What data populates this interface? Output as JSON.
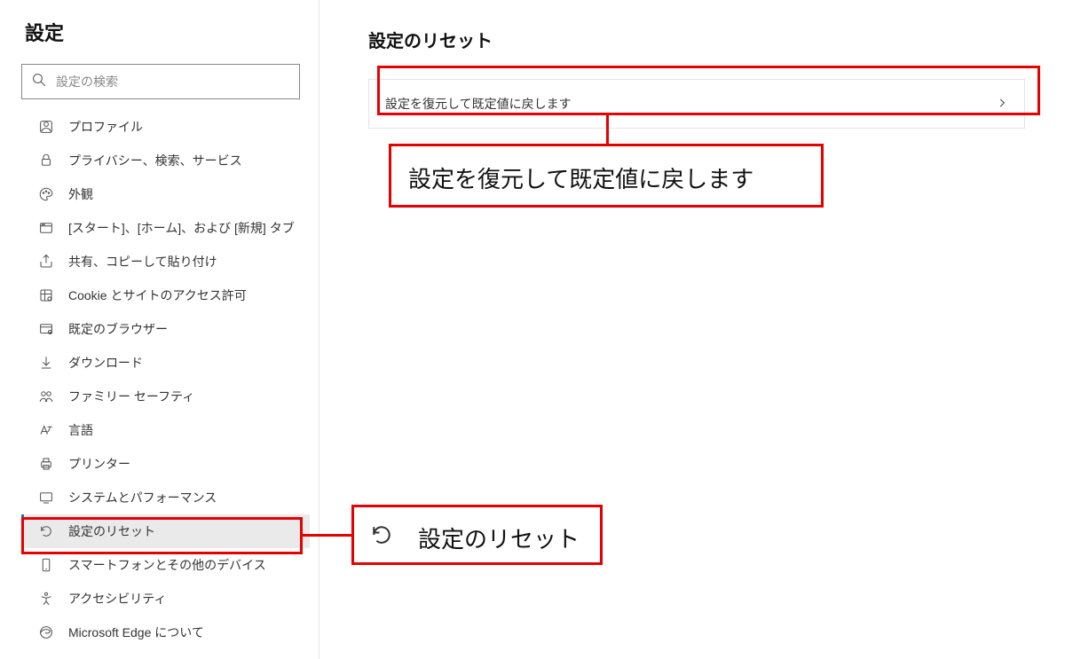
{
  "sidebar": {
    "title": "設定",
    "search_placeholder": "設定の検索",
    "items": [
      {
        "label": "プロファイル"
      },
      {
        "label": "プライバシー、検索、サービス"
      },
      {
        "label": "外観"
      },
      {
        "label": "[スタート]、[ホーム]、および [新規] タブ"
      },
      {
        "label": "共有、コピーして貼り付け"
      },
      {
        "label": "Cookie とサイトのアクセス許可"
      },
      {
        "label": "既定のブラウザー"
      },
      {
        "label": "ダウンロード"
      },
      {
        "label": "ファミリー セーフティ"
      },
      {
        "label": "言語"
      },
      {
        "label": "プリンター"
      },
      {
        "label": "システムとパフォーマンス"
      },
      {
        "label": "設定のリセット"
      },
      {
        "label": "スマートフォンとその他のデバイス"
      },
      {
        "label": "アクセシビリティ"
      },
      {
        "label": "Microsoft Edge について"
      }
    ]
  },
  "main": {
    "title": "設定のリセット",
    "option_label": "設定を復元して既定値に戻します"
  },
  "callouts": {
    "enlarged_option": "設定を復元して既定値に戻します",
    "enlarged_nav": "設定のリセット"
  }
}
